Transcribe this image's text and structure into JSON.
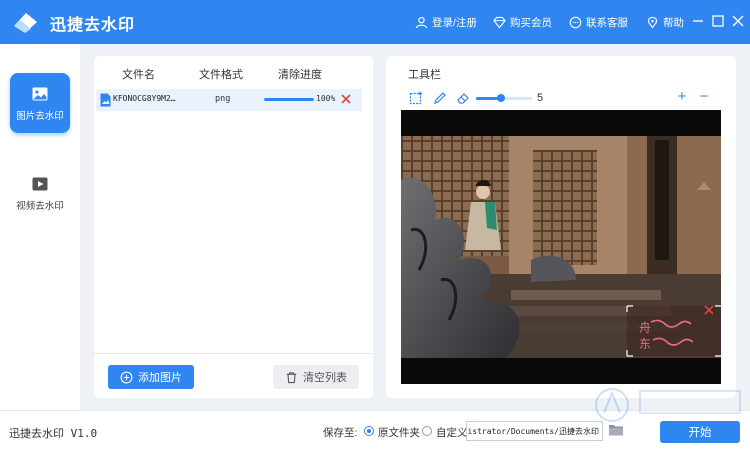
{
  "header": {
    "title": "迅捷去水印",
    "login": "登录/注册",
    "buy": "购买会员",
    "service": "联系客服",
    "help": "帮助"
  },
  "sidebar": {
    "items": [
      {
        "label": "图片去水印",
        "active": true,
        "icon": "image-icon"
      },
      {
        "label": "视频去水印",
        "active": false,
        "icon": "video-icon"
      }
    ]
  },
  "file_panel": {
    "columns": [
      "文件名",
      "文件格式",
      "清除进度"
    ],
    "files": [
      {
        "name": "KFONOCG8Y9M2…",
        "format": "png",
        "progress": 1.0,
        "progress_text": "100%"
      }
    ],
    "add_button": "添加图片",
    "clear_button": "清空列表"
  },
  "toolbar": {
    "title": "工具栏",
    "brush_size": 5,
    "tools": [
      "select-rect-icon",
      "pen-icon",
      "eraser-icon"
    ],
    "zoom_in": "+",
    "zoom_out": "−"
  },
  "preview": {
    "watermark_line1": "舟",
    "watermark_line2": "东"
  },
  "footer": {
    "version": "迅捷去水印 V1.0",
    "save_to_label": "保存至:",
    "option_original": "原文件夹",
    "option_custom": "自定义",
    "path": "istrator/Documents/迅捷去水印",
    "start_button": "开始"
  },
  "colors": {
    "accent": "#2f86f0",
    "delete": "#e24444"
  }
}
